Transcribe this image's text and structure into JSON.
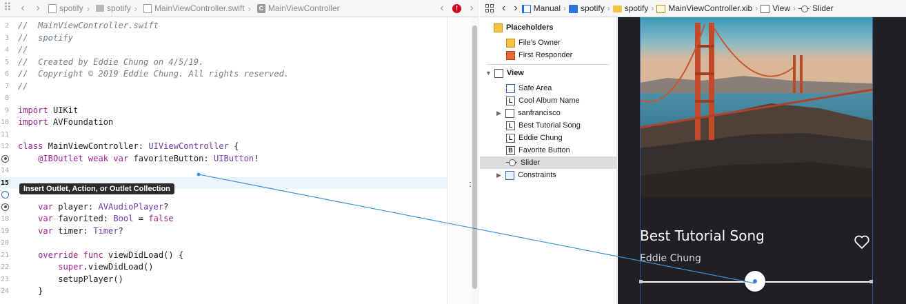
{
  "editor": {
    "breadcrumbs": [
      "spotify",
      "spotify",
      "MainViewController.swift",
      "MainViewController"
    ],
    "lines": [
      {
        "n": "2",
        "segs": [
          {
            "c": "cmt",
            "t": "//  MainViewController.swift"
          }
        ]
      },
      {
        "n": "3",
        "segs": [
          {
            "c": "cmt",
            "t": "//  spotify"
          }
        ]
      },
      {
        "n": "4",
        "segs": [
          {
            "c": "cmt",
            "t": "//"
          }
        ]
      },
      {
        "n": "5",
        "segs": [
          {
            "c": "cmt",
            "t": "//  Created by Eddie Chung on 4/5/19."
          }
        ]
      },
      {
        "n": "6",
        "segs": [
          {
            "c": "cmt",
            "t": "//  Copyright © 2019 Eddie Chung. All rights reserved."
          }
        ]
      },
      {
        "n": "7",
        "segs": [
          {
            "c": "cmt",
            "t": "//"
          }
        ]
      },
      {
        "n": "8",
        "segs": []
      },
      {
        "n": "9",
        "segs": [
          {
            "c": "kw",
            "t": "import"
          },
          {
            "c": "",
            "t": " UIKit"
          }
        ]
      },
      {
        "n": "10",
        "segs": [
          {
            "c": "kw",
            "t": "import"
          },
          {
            "c": "",
            "t": " AVFoundation"
          }
        ]
      },
      {
        "n": "11",
        "segs": []
      },
      {
        "n": "12",
        "segs": [
          {
            "c": "kw",
            "t": "class"
          },
          {
            "c": "",
            "t": " MainViewController: "
          },
          {
            "c": "tyo",
            "t": "UIViewController"
          },
          {
            "c": "",
            "t": " {"
          }
        ]
      },
      {
        "n": "13",
        "segs": [
          {
            "c": "",
            "t": "    "
          },
          {
            "c": "kw",
            "t": "@IBOutlet weak var"
          },
          {
            "c": "",
            "t": " favoriteButton: "
          },
          {
            "c": "tyo",
            "t": "UIButton"
          },
          {
            "c": "",
            "t": "!"
          }
        ]
      },
      {
        "n": "14",
        "segs": []
      },
      {
        "n": "15",
        "segs": []
      },
      {
        "n": "16",
        "segs": []
      },
      {
        "n": "17",
        "segs": [
          {
            "c": "",
            "t": "    "
          },
          {
            "c": "kw",
            "t": "var"
          },
          {
            "c": "",
            "t": " player: "
          },
          {
            "c": "tyo",
            "t": "AVAudioPlayer"
          },
          {
            "c": "",
            "t": "?"
          }
        ]
      },
      {
        "n": "18",
        "segs": [
          {
            "c": "",
            "t": "    "
          },
          {
            "c": "kw",
            "t": "var"
          },
          {
            "c": "",
            "t": " favorited: "
          },
          {
            "c": "tyo",
            "t": "Bool"
          },
          {
            "c": "",
            "t": " = "
          },
          {
            "c": "kw",
            "t": "false"
          }
        ]
      },
      {
        "n": "19",
        "segs": [
          {
            "c": "",
            "t": "    "
          },
          {
            "c": "kw",
            "t": "var"
          },
          {
            "c": "",
            "t": " timer: "
          },
          {
            "c": "tyo",
            "t": "Timer"
          },
          {
            "c": "",
            "t": "?"
          }
        ]
      },
      {
        "n": "20",
        "segs": []
      },
      {
        "n": "21",
        "segs": [
          {
            "c": "",
            "t": "    "
          },
          {
            "c": "kw",
            "t": "override func"
          },
          {
            "c": "",
            "t": " viewDidLoad() {"
          }
        ]
      },
      {
        "n": "22",
        "segs": [
          {
            "c": "",
            "t": "        "
          },
          {
            "c": "kw",
            "t": "super"
          },
          {
            "c": "",
            "t": ".viewDidLoad()"
          }
        ]
      },
      {
        "n": "23",
        "segs": [
          {
            "c": "",
            "t": "        setupPlayer()"
          }
        ]
      },
      {
        "n": "24",
        "segs": [
          {
            "c": "",
            "t": "    }"
          }
        ]
      }
    ],
    "tooltip": "Insert Outlet, Action, or Outlet Collection",
    "error_badge": "!"
  },
  "ib": {
    "breadcrumbs": [
      "Manual",
      "spotify",
      "spotify",
      "MainViewController.xib",
      "View",
      "Slider"
    ],
    "outline": {
      "placeholders_header": "Placeholders",
      "placeholders": [
        "File's Owner",
        "First Responder"
      ],
      "view_header": "View",
      "items": [
        {
          "label": "Safe Area",
          "icon": "safe-area-icon",
          "glyph": ""
        },
        {
          "label": "Cool Album Name",
          "icon": "label-icon",
          "glyph": "L"
        },
        {
          "label": "sanfrancisco",
          "icon": "image-view-icon",
          "glyph": ""
        },
        {
          "label": "Best Tutorial Song",
          "icon": "label-icon",
          "glyph": "L"
        },
        {
          "label": "Eddie Chung",
          "icon": "label-icon",
          "glyph": "L"
        },
        {
          "label": "Favorite Button",
          "icon": "button-icon",
          "glyph": "B"
        },
        {
          "label": "Slider",
          "icon": "slider-icon",
          "glyph": ""
        },
        {
          "label": "Constraints",
          "icon": "constraints-icon",
          "glyph": ""
        }
      ]
    },
    "canvas": {
      "song_title": "Best Tutorial Song",
      "artist": "Eddie Chung"
    }
  },
  "colors": {
    "comment": "#707f8c",
    "keyword": "#9b2393",
    "type": "#703daa",
    "accent": "#3b7fd6",
    "device_bg": "#1f2024"
  }
}
